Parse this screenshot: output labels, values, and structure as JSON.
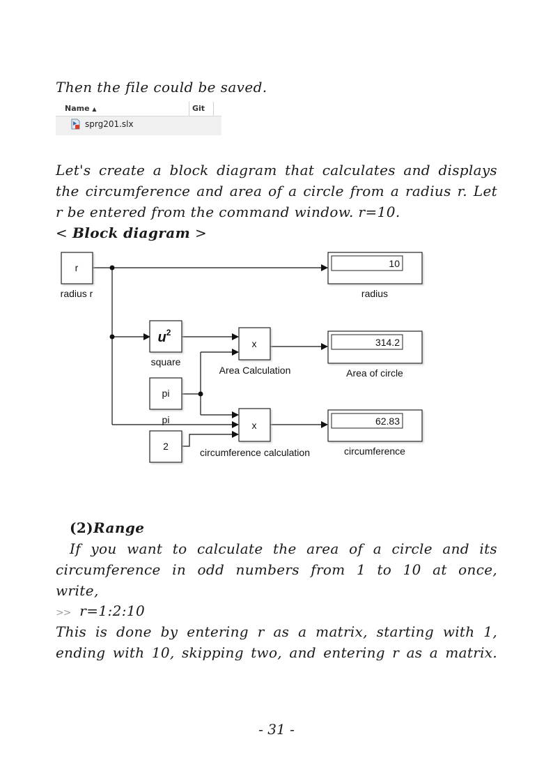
{
  "intro_line": "Then the file could be saved.",
  "file_browser": {
    "columns": [
      {
        "label": "Name",
        "sort": "ascending"
      },
      {
        "label": "Git"
      }
    ],
    "files": [
      {
        "name": "sprg201.slx",
        "icon": "simulink-model-icon"
      }
    ]
  },
  "paragraph1": [
    "Let's create a block diagram that calculates and displays",
    "the circumference and area of a circle from a radius r. Let",
    "r be entered from the command window. r=10."
  ],
  "diagram_heading": {
    "open": "<",
    "title": "Block diagram",
    "close": ">"
  },
  "block_diagram": {
    "blocks": {
      "radius_in": {
        "text": "r",
        "label": "radius r"
      },
      "square": {
        "text": "u",
        "superscript": "2",
        "label": "square"
      },
      "pi": {
        "text": "pi",
        "label": "pi"
      },
      "two": {
        "text": "2"
      },
      "area_product": {
        "text": "x",
        "label": "Area Calculation"
      },
      "circ_product": {
        "text": "x",
        "label": "circumference calculation"
      },
      "radius_display": {
        "value": "10",
        "label": "radius"
      },
      "area_display": {
        "value": "314.2",
        "label": "Area of circle"
      },
      "circ_display": {
        "value": "62.83",
        "label": "circumference"
      }
    }
  },
  "section2": {
    "heading_num": "(2)",
    "heading_title": "Range",
    "lines": [
      "If you want to calculate the area of a circle and its",
      "circumference in odd numbers from 1 to 10 at once,"
    ],
    "line3": "write,",
    "prompt": ">>",
    "command": "r=1:2:10",
    "explain": [
      "This is done by entering r as a matrix, starting with 1,",
      "ending with 10, skipping two, and entering r as a matrix."
    ]
  },
  "page_number": "- 31 -"
}
